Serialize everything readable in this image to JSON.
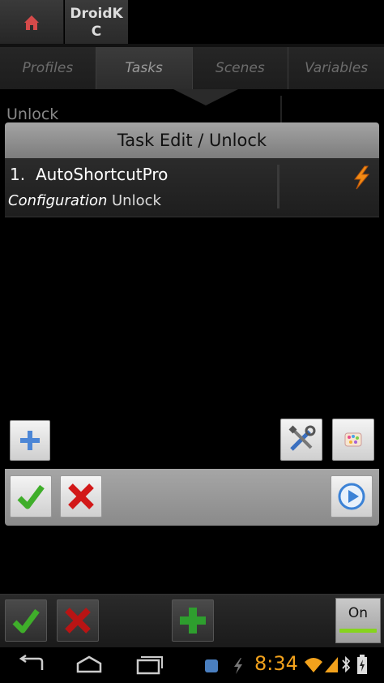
{
  "project_tab": {
    "label": "DroidK\nC"
  },
  "main_tabs": [
    {
      "label": "Profiles"
    },
    {
      "label": "Tasks"
    },
    {
      "label": "Scenes"
    },
    {
      "label": "Variables"
    }
  ],
  "background_list": {
    "task_name": "Unlock"
  },
  "dialog": {
    "title": "Task Edit / Unlock",
    "action": {
      "number": "1.",
      "name": "AutoShortcutPro",
      "config_label": "Configuration",
      "config_value": "Unlock"
    }
  },
  "bottom_bar": {
    "toggle_label": "On"
  },
  "status_bar": {
    "time": "8:34"
  },
  "colors": {
    "accent_green": "#86d41e",
    "clock_orange": "#f3a21c",
    "check_green": "#3fae2a",
    "cross_red": "#d21818"
  },
  "icons": [
    "home-icon",
    "lightning-icon",
    "plus-icon",
    "tools-icon",
    "color-palette-icon",
    "checkmark-icon",
    "cross-icon",
    "play-icon",
    "back-icon",
    "home-nav-icon",
    "recent-apps-icon",
    "wifi-icon",
    "signal-icon",
    "bluetooth-icon"
  ]
}
